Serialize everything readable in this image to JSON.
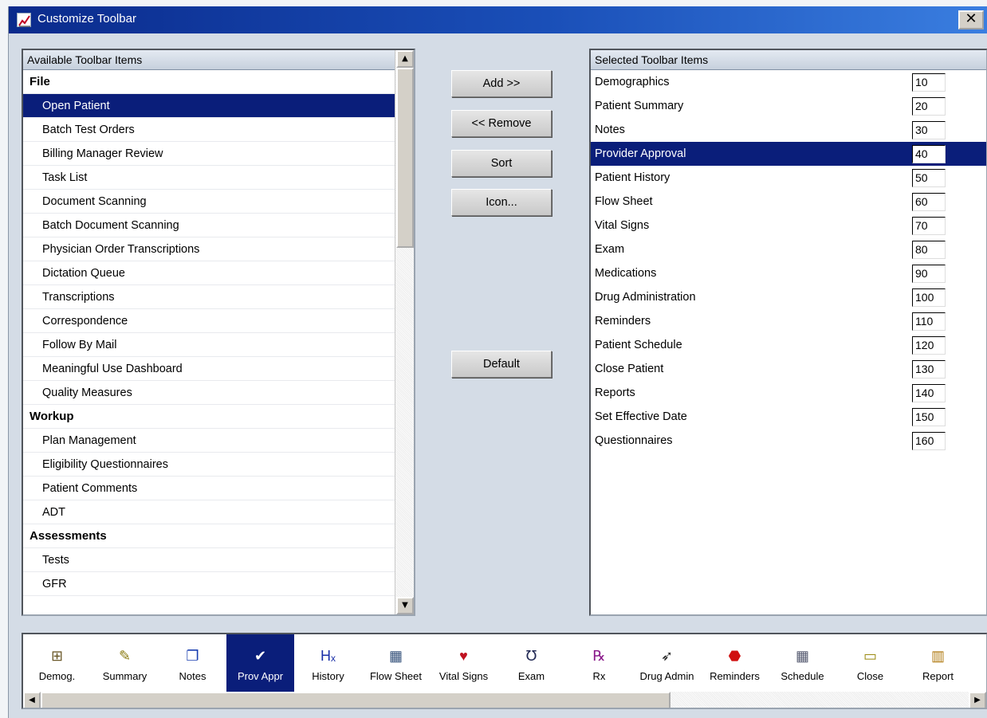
{
  "window": {
    "title": "Customize Toolbar",
    "close_label": "✕"
  },
  "available": {
    "header": "Available Toolbar Items",
    "rows": [
      {
        "label": "File",
        "type": "group"
      },
      {
        "label": "Open Patient",
        "type": "item",
        "selected": true
      },
      {
        "label": "Batch Test Orders",
        "type": "item"
      },
      {
        "label": "Billing Manager Review",
        "type": "item"
      },
      {
        "label": "Task List",
        "type": "item"
      },
      {
        "label": "Document Scanning",
        "type": "item"
      },
      {
        "label": "Batch Document Scanning",
        "type": "item"
      },
      {
        "label": "Physician Order Transcriptions",
        "type": "item"
      },
      {
        "label": "Dictation Queue",
        "type": "item"
      },
      {
        "label": "Transcriptions",
        "type": "item"
      },
      {
        "label": "Correspondence",
        "type": "item"
      },
      {
        "label": "Follow By Mail",
        "type": "item"
      },
      {
        "label": "Meaningful Use Dashboard",
        "type": "item"
      },
      {
        "label": "Quality Measures",
        "type": "item"
      },
      {
        "label": "Workup",
        "type": "group"
      },
      {
        "label": "Plan Management",
        "type": "item"
      },
      {
        "label": "Eligibility Questionnaires",
        "type": "item"
      },
      {
        "label": "Patient Comments",
        "type": "item"
      },
      {
        "label": "ADT",
        "type": "item"
      },
      {
        "label": "Assessments",
        "type": "group"
      },
      {
        "label": "Tests",
        "type": "item"
      },
      {
        "label": "GFR",
        "type": "item"
      }
    ]
  },
  "buttons": {
    "add": "Add >>",
    "remove": "<< Remove",
    "sort": "Sort",
    "icon": "Icon...",
    "default": "Default"
  },
  "selected": {
    "header": "Selected Toolbar Items",
    "rows": [
      {
        "label": "Demographics",
        "order": "10"
      },
      {
        "label": "Patient Summary",
        "order": "20"
      },
      {
        "label": "Notes",
        "order": "30"
      },
      {
        "label": "Provider Approval",
        "order": "40",
        "selected": true
      },
      {
        "label": "Patient History",
        "order": "50"
      },
      {
        "label": "Flow Sheet",
        "order": "60"
      },
      {
        "label": "Vital Signs",
        "order": "70"
      },
      {
        "label": "Exam",
        "order": "80"
      },
      {
        "label": "Medications",
        "order": "90"
      },
      {
        "label": "Drug Administration",
        "order": "100"
      },
      {
        "label": "Reminders",
        "order": "110"
      },
      {
        "label": "Patient Schedule",
        "order": "120"
      },
      {
        "label": "Close Patient",
        "order": "130"
      },
      {
        "label": "Reports",
        "order": "140"
      },
      {
        "label": "Set Effective Date",
        "order": "150"
      },
      {
        "label": "Questionnaires",
        "order": "160"
      }
    ]
  },
  "toolbar_preview": {
    "items": [
      {
        "label": "Demog.",
        "icon": "org-chart-icon",
        "glyph": "⊞",
        "color": "#6b5a2a"
      },
      {
        "label": "Summary",
        "icon": "note-pad-icon",
        "glyph": "✎",
        "color": "#8a7a10"
      },
      {
        "label": "Notes",
        "icon": "notes-icon",
        "glyph": "❐",
        "color": "#1a3fb0"
      },
      {
        "label": "Prov Appr",
        "icon": "approval-icon",
        "glyph": "✔",
        "color": "#ffffff",
        "selected": true
      },
      {
        "label": "History",
        "icon": "history-hx-icon",
        "glyph": "Hₓ",
        "color": "#1a2fa8"
      },
      {
        "label": "Flow Sheet",
        "icon": "grid-icon",
        "glyph": "▦",
        "color": "#33507a"
      },
      {
        "label": "Vital Signs",
        "icon": "vital-chart-icon",
        "glyph": "♥",
        "color": "#c01020"
      },
      {
        "label": "Exam",
        "icon": "stethoscope-icon",
        "glyph": "℧",
        "color": "#222a55"
      },
      {
        "label": "Rx",
        "icon": "rx-icon",
        "glyph": "℞",
        "color": "#8a1a8a"
      },
      {
        "label": "Drug Admin",
        "icon": "syringe-icon",
        "glyph": "➶",
        "color": "#222222"
      },
      {
        "label": "Reminders",
        "icon": "stop-sign-icon",
        "glyph": "⬣",
        "color": "#d01010"
      },
      {
        "label": "Schedule",
        "icon": "calendar-icon",
        "glyph": "▦",
        "color": "#555a70"
      },
      {
        "label": "Close",
        "icon": "folder-icon",
        "glyph": "▭",
        "color": "#9a8a10"
      },
      {
        "label": "Report",
        "icon": "bar-chart-icon",
        "glyph": "▥",
        "color": "#b07a10"
      }
    ]
  }
}
